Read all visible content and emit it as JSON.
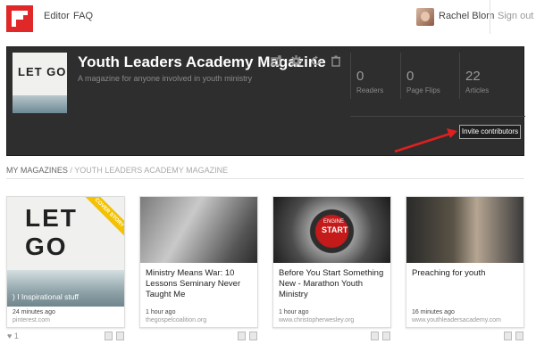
{
  "nav": {
    "editor": "Editor",
    "faq": "FAQ",
    "username": "Rachel Blom",
    "signout": "Sign out"
  },
  "magazine": {
    "cover_text": "LET GO",
    "title": "Youth Leaders Academy Magazine",
    "subtitle": "A magazine for anyone involved in youth ministry",
    "stats": [
      {
        "value": "0",
        "label": "Readers"
      },
      {
        "value": "0",
        "label": "Page Flips"
      },
      {
        "value": "22",
        "label": "Articles"
      }
    ],
    "invite_label": "Invite contributors"
  },
  "breadcrumb": {
    "root": "MY MAGAZINES",
    "current": "YOUTH LEADERS ACADEMY MAGAZINE"
  },
  "cards": [
    {
      "image_text": "LET GO",
      "ribbon": "COVER STORY",
      "caption": ") I Inspirational stuff",
      "time": "24 minutes ago",
      "source": "pinterest.com",
      "likes": "1"
    },
    {
      "title": "Ministry Means War: 10 Lessons Seminary Never Taught Me",
      "time": "1 hour ago",
      "source": "thegospelcoalition.org"
    },
    {
      "image_text_small": "ENGINE",
      "image_text_big": "START",
      "title": "Before You Start Something New - Marathon Youth Ministry",
      "time": "1 hour ago",
      "source": "www.christopherwesley.org"
    },
    {
      "title": "Preaching for youth",
      "time": "16 minutes ago",
      "source": "www.youthleadersacademy.com"
    }
  ],
  "colors": {
    "brand": "#e12828",
    "panel": "#2e2e2e",
    "ribbon": "#f3c200",
    "arrow": "#e02020"
  }
}
